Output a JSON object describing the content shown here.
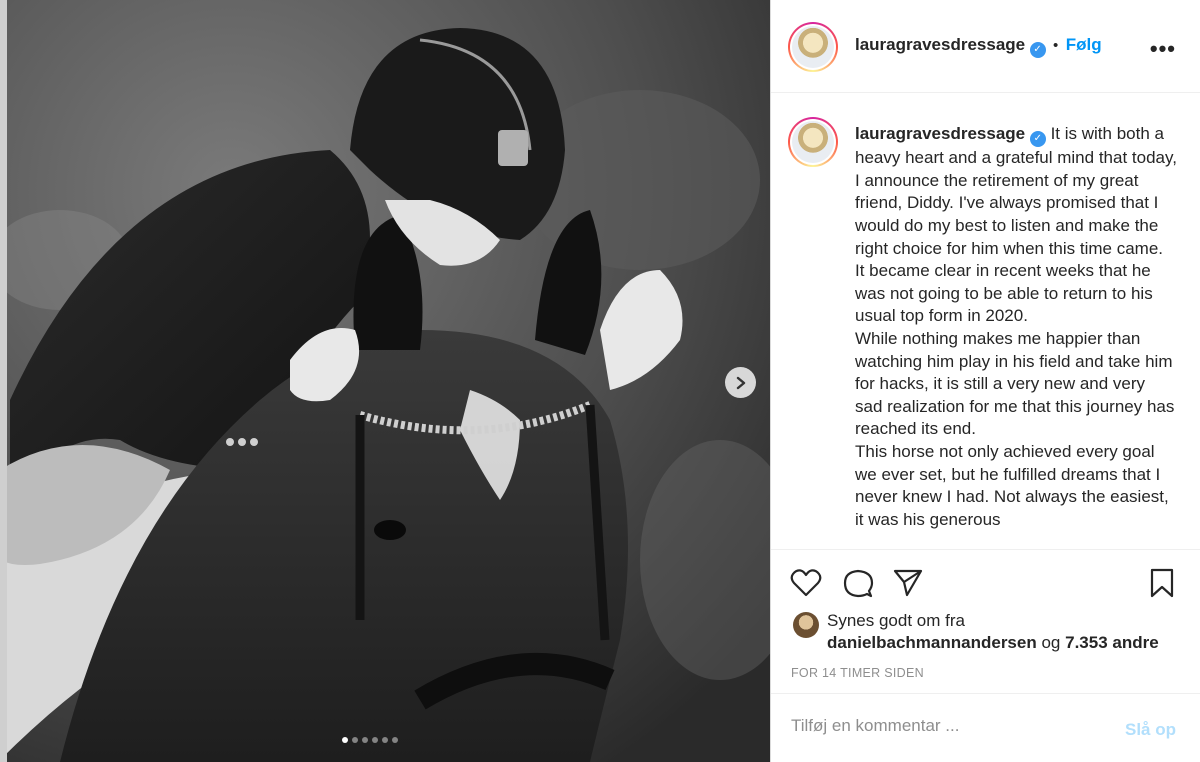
{
  "post": {
    "username": "lauragravesdressage",
    "follow_label": "Følg",
    "more_label": "•••",
    "caption_paragraphs": [
      "It is with both a heavy heart and a grateful mind that today, I announce the retirement of my great friend, Diddy. I've always promised that I would do my best to listen and make the right choice for him when this time came. It became clear in recent weeks that he was not going to be able to return to his usual top form in 2020.",
      "While nothing makes me happier than watching him play in his field and take him for hacks, it is still a very new and very sad realization for me that this journey has reached its end.",
      "This horse not only achieved every goal we ever set, but he fulfilled dreams that I never knew I had. Not always the easiest, it was his generous"
    ],
    "likes": {
      "prefix": "Synes godt om fra",
      "liker": "danielbachmannandersen",
      "joiner": "og",
      "others": "7.353 andre"
    },
    "timestamp": "FOR 14 TIMER SIDEN",
    "comment": {
      "placeholder": "Tilføj en kommentar ...",
      "post_label": "Slå op"
    }
  },
  "carousel": {
    "slide_count": 6,
    "active_index": 0
  },
  "colors": {
    "link_blue": "#0095f6",
    "verified_blue": "#3897f0",
    "muted_gray": "#8e8e8e",
    "post_disabled": "#b2dffc"
  }
}
